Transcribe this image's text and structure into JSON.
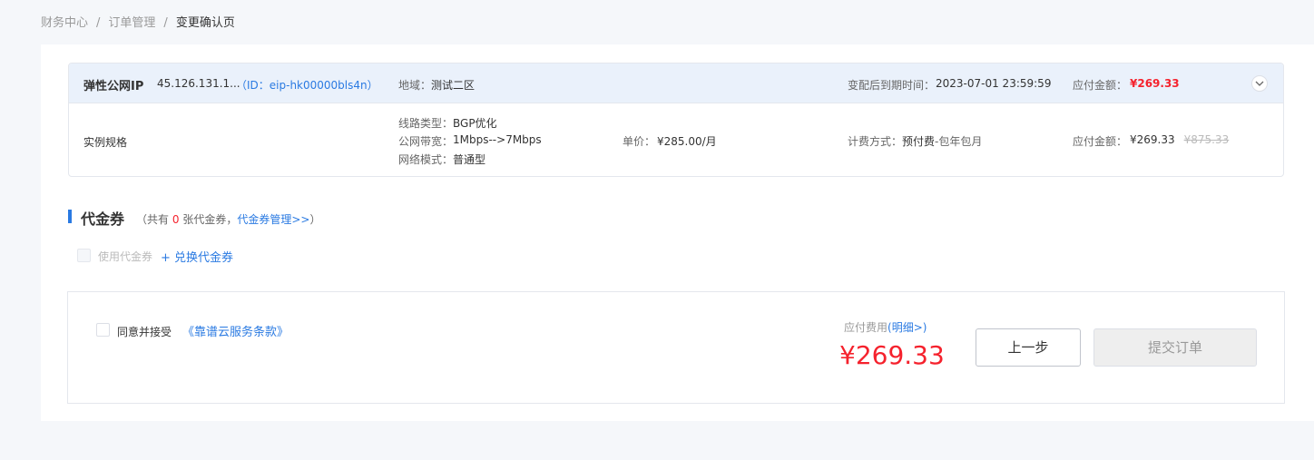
{
  "breadcrumb": {
    "items": [
      "财务中心",
      "订单管理",
      "变更确认页"
    ],
    "separator": "/"
  },
  "order": {
    "product_name": "弹性公网IP",
    "ip": "45.126.131.1...",
    "id_text": "（ID：eip-hk00000bls4n）",
    "region_label": "地域：",
    "region_value": "测试二区",
    "expire_label": "变配后到期时间：",
    "expire_value": "2023-07-01 23:59:59",
    "pay_label": "应付金额：",
    "pay_value": "¥269.33",
    "spec": {
      "title": "实例规格",
      "line_type_label": "线路类型：",
      "line_type_value": "BGP优化",
      "bandwidth_label": "公网带宽：",
      "bandwidth_value": "1Mbps-->7Mbps",
      "network_mode_label": "网络模式：",
      "network_mode_value": "普通型",
      "unit_price_label": "单价：",
      "unit_price_value": "¥285.00/月",
      "billing_label": "计费方式：",
      "billing_value": "预付费",
      "billing_suffix": "-包年包月",
      "pay_label": "应付金额：",
      "pay_value": "¥269.33",
      "original_price": "¥875.33"
    }
  },
  "voucher": {
    "title": "代金券",
    "sub_prefix": "（共有",
    "count": "0",
    "sub_middle": "张代金券，",
    "manage_link": "代金券管理>>",
    "sub_suffix": "）",
    "use_label": "使用代金券",
    "exchange_link": "+ 兑换代金券"
  },
  "footer": {
    "agree_label": "同意并接受",
    "terms_link": "《靠谱云服务条款》",
    "fee_label": "应付费用",
    "detail_link": "(明细>)",
    "total": "¥269.33",
    "prev_button": "上一步",
    "submit_button": "提交订单"
  },
  "colors": {
    "accent": "#2a7ae2",
    "price_red": "#f5222d",
    "header_bg": "#eaf1fb"
  }
}
